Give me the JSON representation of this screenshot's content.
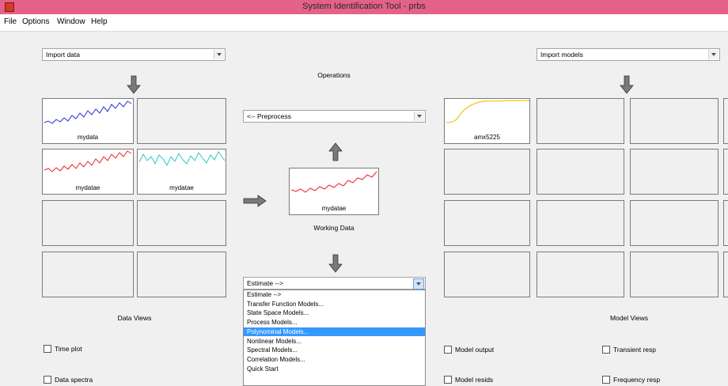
{
  "window": {
    "title": "System Identification Tool - prbs"
  },
  "menu": [
    "File",
    "Options",
    "Window",
    "Help"
  ],
  "import_data": {
    "value": "Import data"
  },
  "import_models": {
    "value": "Import models"
  },
  "operations": {
    "label": "Operations"
  },
  "preprocess": {
    "value": "<-- Preprocess"
  },
  "working_data": {
    "name": "mydatae",
    "label": "Working Data"
  },
  "estimate": {
    "value": "Estimate -->",
    "options": [
      "Estimate -->",
      "Transfer Function Models...",
      "State Space Models...",
      "Process Models...",
      "Polynominal Models...",
      "Nonlinear Models...",
      "Spectral Models...",
      "Correlation Models...",
      "Quick Start"
    ],
    "selected": "Polynominal Models..."
  },
  "data_boards": [
    {
      "name": "mydata",
      "color": "#2a2ad9"
    },
    {
      "name": ""
    },
    {
      "name": "mydatae",
      "color": "#ee2222"
    },
    {
      "name": "mydatae",
      "color": "#2ec8c8"
    },
    {
      "name": ""
    },
    {
      "name": ""
    },
    {
      "name": ""
    },
    {
      "name": ""
    }
  ],
  "model_boards": [
    {
      "name": "amx5225",
      "color": "#f0c419"
    },
    {
      "name": ""
    },
    {
      "name": ""
    },
    {
      "name": ""
    },
    {
      "name": ""
    },
    {
      "name": ""
    },
    {
      "name": ""
    },
    {
      "name": ""
    },
    {
      "name": ""
    },
    {
      "name": ""
    },
    {
      "name": ""
    },
    {
      "name": ""
    },
    {
      "name": ""
    },
    {
      "name": ""
    },
    {
      "name": ""
    },
    {
      "name": ""
    }
  ],
  "data_views": {
    "title": "Data Views",
    "checks": [
      {
        "label": "Time plot",
        "checked": false
      },
      {
        "label": "Data spectra",
        "checked": false
      }
    ]
  },
  "model_views": {
    "title": "Model Views",
    "checks": [
      {
        "label": "Model output",
        "checked": false
      },
      {
        "label": "Model resids",
        "checked": false
      },
      {
        "label": "Transient resp",
        "checked": false
      },
      {
        "label": "Frequency resp",
        "checked": false
      }
    ]
  }
}
